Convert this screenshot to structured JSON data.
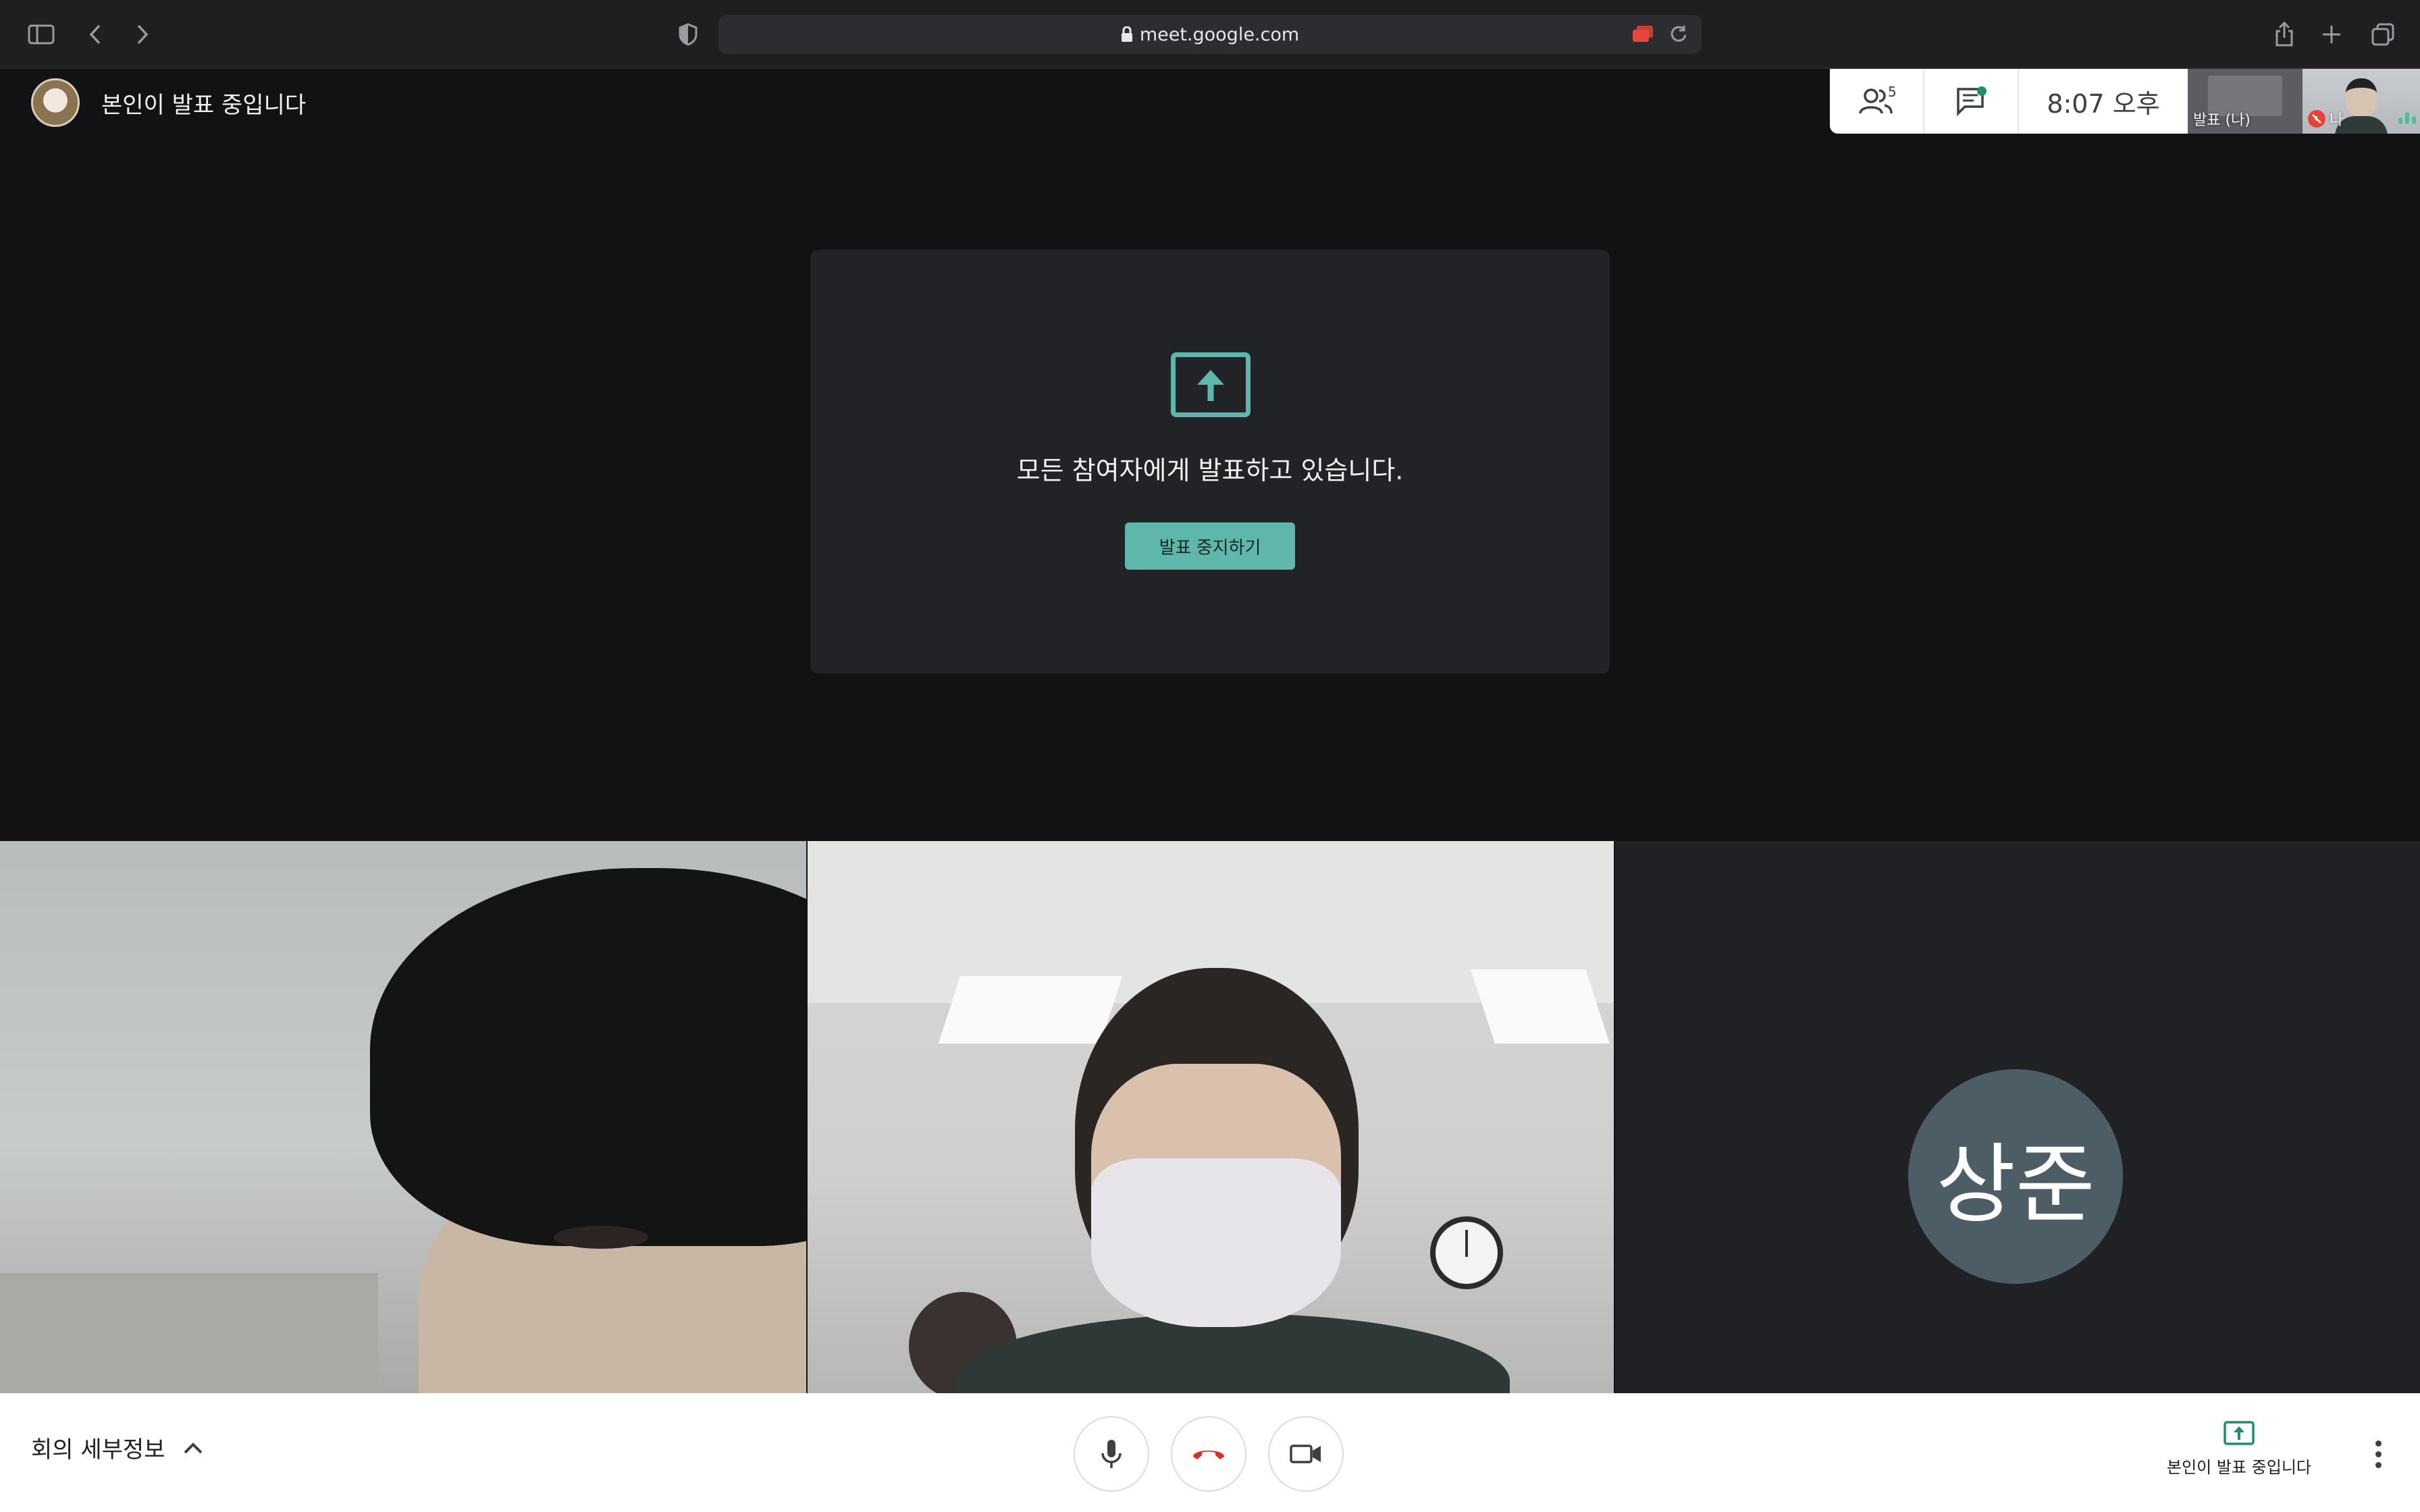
{
  "browser": {
    "url": "meet.google.com"
  },
  "top": {
    "presenter_label": "본인이 발표 중입니다",
    "participants_count": "5",
    "clock": "8:07 오후",
    "thumb_presentation_label": "발표 (나)",
    "thumb_self_label": "나"
  },
  "card": {
    "message": "모든 참여자에게 발표하고 있습니다.",
    "stop_button": "발표 중지하기"
  },
  "tiles": {
    "third_initials": "상준"
  },
  "bottom": {
    "details_label": "회의 세부정보",
    "present_status": "본인이 발표 중입니다"
  },
  "colors": {
    "accent": "#5fb6aa",
    "hangup": "#d93025",
    "avatar_bg": "#4c5d66"
  }
}
